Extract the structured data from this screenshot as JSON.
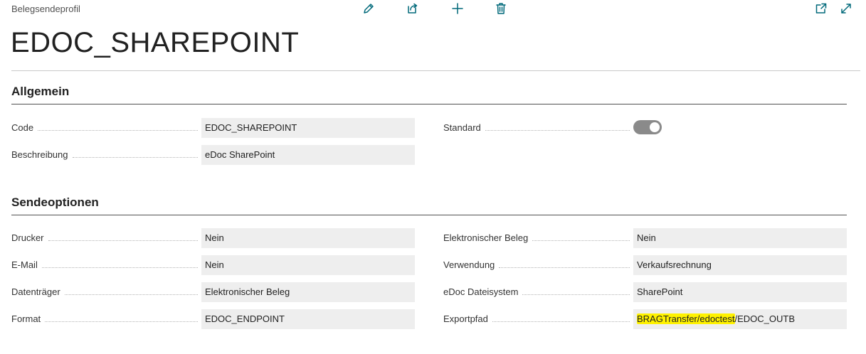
{
  "header": {
    "caption": "Belegsendeprofil",
    "title": "EDOC_SHAREPOINT",
    "toolbar_icons": [
      "pencil-icon",
      "share-icon",
      "plus-icon",
      "trash-icon",
      "open-new-window-icon",
      "expand-icon"
    ]
  },
  "sections": {
    "general": {
      "title": "Allgemein",
      "fields": {
        "code": {
          "label": "Code",
          "value": "EDOC_SHAREPOINT"
        },
        "description": {
          "label": "Beschreibung",
          "value": "eDoc SharePoint"
        },
        "standard": {
          "label": "Standard",
          "value": true
        }
      }
    },
    "send_options": {
      "title": "Sendeoptionen",
      "fields": {
        "printer": {
          "label": "Drucker",
          "value": "Nein"
        },
        "email": {
          "label": "E-Mail",
          "value": "Nein"
        },
        "disk": {
          "label": "Datenträger",
          "value": "Elektronischer Beleg"
        },
        "format": {
          "label": "Format",
          "value": "EDOC_ENDPOINT"
        },
        "electronic_doc": {
          "label": "Elektronischer Beleg",
          "value": "Nein"
        },
        "usage": {
          "label": "Verwendung",
          "value": "Verkaufsrechnung"
        },
        "edoc_filesystem": {
          "label": "eDoc Dateisystem",
          "value": "SharePoint"
        },
        "export_path": {
          "label": "Exportpfad",
          "value_highlighted": "BRAGTransfer/edoctest",
          "value_rest": "/EDOC_OUTB"
        }
      }
    }
  },
  "colors": {
    "accent": "#00697a",
    "field_bg": "#eeeeee",
    "toggle_bg": "#8a8a8a",
    "highlight": "#fff200"
  }
}
